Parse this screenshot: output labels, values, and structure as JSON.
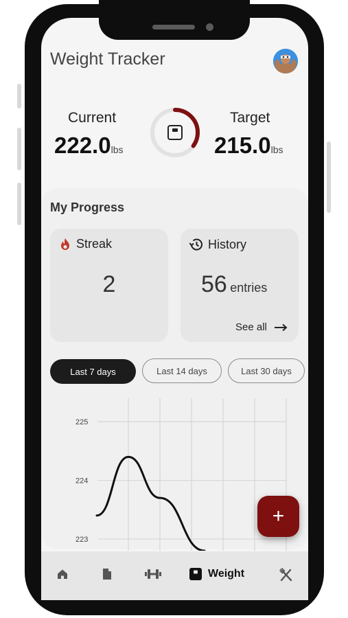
{
  "app": {
    "title": "Weight Tracker"
  },
  "stats": {
    "current": {
      "label": "Current",
      "value": "222.0",
      "unit": "lbs"
    },
    "target": {
      "label": "Target",
      "value": "215.0",
      "unit": "lbs"
    },
    "progress_fraction": 0.35,
    "accent": "#7e1010"
  },
  "progress": {
    "title": "My Progress",
    "streak": {
      "label": "Streak",
      "value": "2"
    },
    "history": {
      "label": "History",
      "value": "56",
      "unit": "entries",
      "see_all": "See all"
    }
  },
  "filters": [
    {
      "label": "Last 7 days",
      "active": true
    },
    {
      "label": "Last 14 days",
      "active": false
    },
    {
      "label": "Last 30 days",
      "active": false
    }
  ],
  "chart_data": {
    "type": "line",
    "yticks": [
      "225",
      "224",
      "223"
    ],
    "ylim": [
      222.8,
      225.4
    ],
    "x": [
      0,
      1,
      2,
      3
    ],
    "values": [
      223.4,
      224.4,
      223.7,
      222.8
    ],
    "grid": true
  },
  "fab": {
    "label": "+"
  },
  "nav": {
    "items": [
      {
        "name": "home"
      },
      {
        "name": "notes"
      },
      {
        "name": "workouts"
      },
      {
        "name": "weight",
        "label": "Weight",
        "active": true
      },
      {
        "name": "food"
      }
    ]
  }
}
